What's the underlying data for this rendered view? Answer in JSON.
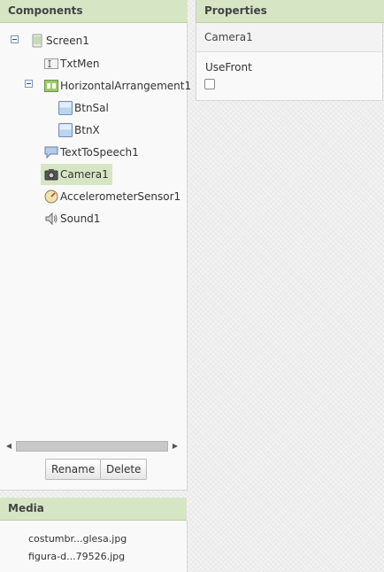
{
  "components": {
    "title": "Components",
    "tree": [
      {
        "label": "Screen1",
        "icon": "screen-icon"
      },
      {
        "label": "TxtMen",
        "icon": "textbox-icon"
      },
      {
        "label": "HorizontalArrangement1",
        "icon": "horizontal-arrangement-icon"
      },
      {
        "label": "BtnSal",
        "icon": "button-icon"
      },
      {
        "label": "BtnX",
        "icon": "button-icon"
      },
      {
        "label": "TextToSpeech1",
        "icon": "speech-icon"
      },
      {
        "label": "Camera1",
        "icon": "camera-icon",
        "selected": true
      },
      {
        "label": "AccelerometerSensor1",
        "icon": "accelerometer-icon"
      },
      {
        "label": "Sound1",
        "icon": "sound-icon"
      }
    ],
    "rename_label": "Rename",
    "delete_label": "Delete"
  },
  "properties": {
    "title": "Properties",
    "selected_component": "Camera1",
    "property_name": "UseFront",
    "property_value": false
  },
  "media": {
    "title": "Media",
    "files": [
      "costumbr...glesa.jpg",
      "figura-d...79526.jpg"
    ]
  },
  "colors": {
    "header_bg": "#d6e6c5",
    "selected_bg": "#d6e6c5",
    "panel_bg": "#f9f9f9"
  }
}
